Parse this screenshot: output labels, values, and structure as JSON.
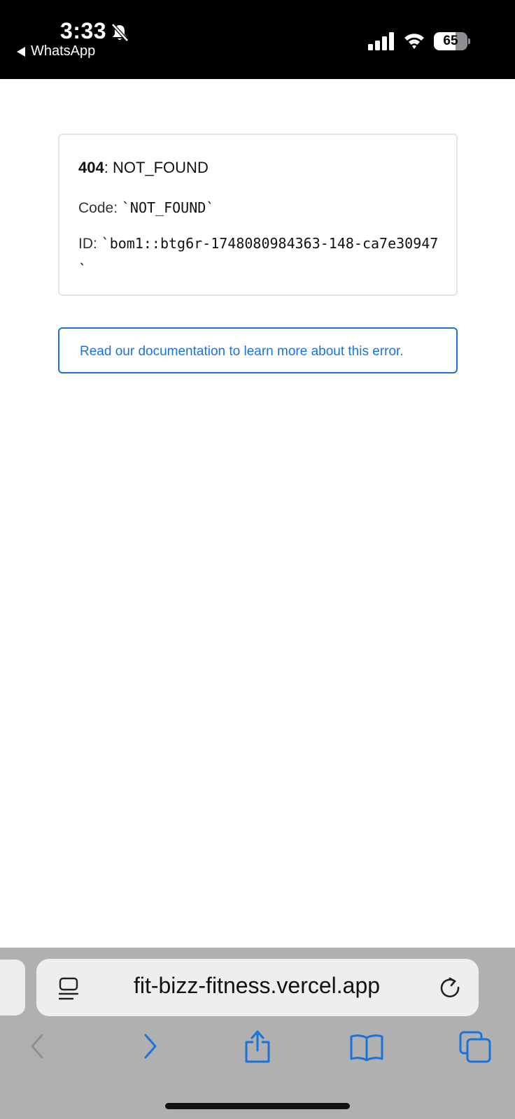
{
  "status_bar": {
    "time": "3:33",
    "back_app_label": "WhatsApp",
    "battery_level": "65",
    "battery_fraction": 0.65,
    "icons": [
      "bell-slash-icon",
      "cellular-signal-icon",
      "wifi-icon",
      "battery-icon"
    ]
  },
  "error": {
    "status_code": "404",
    "status_text": ": NOT_FOUND",
    "code_label": "Code: ",
    "code_value": "`NOT_FOUND`",
    "id_label": "ID: ",
    "id_value": "`bom1::btg6r-1748080984363-148-ca7e30947`"
  },
  "docs": {
    "link_text": "Read our documentation to learn more about this error."
  },
  "browser": {
    "url": "fit-bizz-fitness.vercel.app",
    "toolbar_icons": [
      "reader-mode-icon",
      "reload-icon",
      "back-chevron-icon",
      "forward-chevron-icon",
      "share-icon",
      "bookmarks-icon",
      "tabs-icon"
    ]
  },
  "colors": {
    "link_blue": "#1a73d8",
    "toolbar_gray": "#b0b0b0",
    "address_bar": "#eeeeee",
    "card_border": "#e4e4e4"
  }
}
